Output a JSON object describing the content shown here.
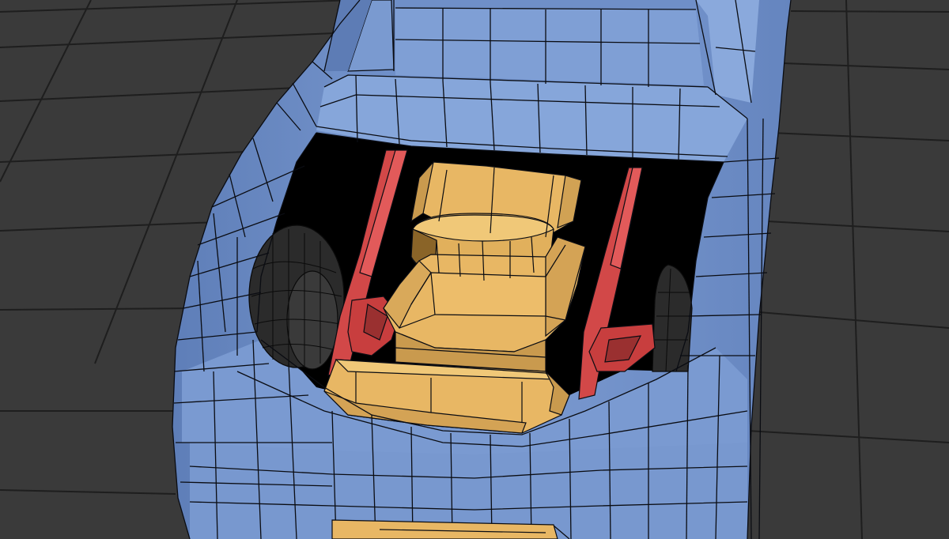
{
  "viewport": {
    "shading": "wireframe-on-shaded",
    "colors": {
      "background": "#3a3a3a",
      "grid_line": "#1e1e1e",
      "body": "#7b9ad0",
      "body_shadow": "#5f7fb8",
      "body_highlight": "#8fb0e0",
      "wire": "#0a0c12",
      "engine": "#e8b764",
      "engine_shadow": "#b88a3c",
      "engine_dark": "#7a5a24",
      "frame": "#d24848",
      "frame_dark": "#8e2a2a",
      "tire": "#2a2a2a",
      "cavity": "#000000"
    }
  },
  "objects": [
    {
      "name": "car-body"
    },
    {
      "name": "engine-block"
    },
    {
      "name": "roll-frame"
    },
    {
      "name": "front-wheel-left"
    },
    {
      "name": "front-wheel-right"
    }
  ]
}
